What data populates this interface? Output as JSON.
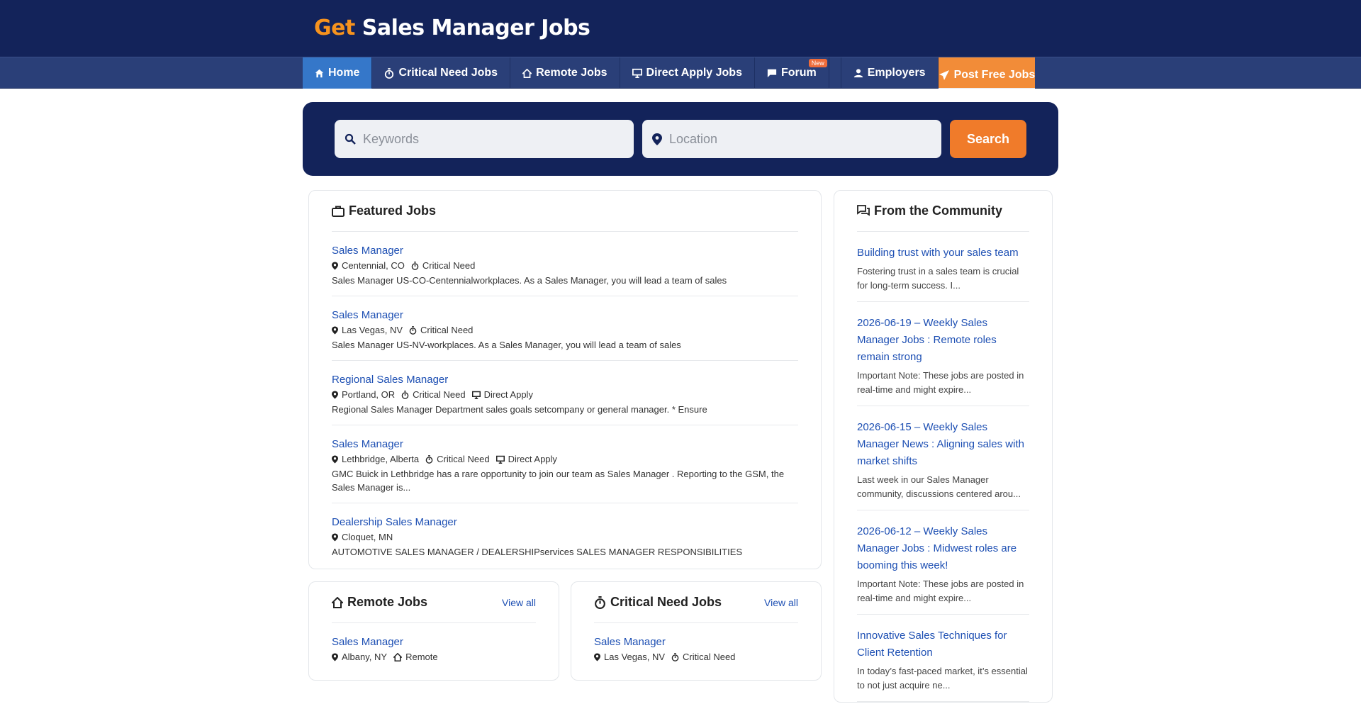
{
  "header": {
    "logo_highlight": "Get",
    "logo_rest": "Sales Manager Jobs"
  },
  "nav": {
    "home": "Home",
    "critical": "Critical Need Jobs",
    "remote": "Remote Jobs",
    "direct": "Direct Apply Jobs",
    "forum": "Forum",
    "forum_badge": "New",
    "employers": "Employers",
    "post": "Post Free Jobs"
  },
  "search": {
    "keywords_placeholder": "Keywords",
    "location_placeholder": "Location",
    "button": "Search"
  },
  "featured": {
    "title": "Featured Jobs",
    "jobs": [
      {
        "title": "Sales Manager",
        "location": "Centennial, CO",
        "tag1": "Critical Need",
        "desc": "Sales Manager US-CO-Centennialworkplaces. As a Sales Manager, you will lead a team of sales"
      },
      {
        "title": "Sales Manager",
        "location": "Las Vegas, NV",
        "tag1": "Critical Need",
        "desc": "Sales Manager US-NV-workplaces. As a Sales Manager, you will lead a team of sales"
      },
      {
        "title": "Regional Sales Manager",
        "location": "Portland, OR",
        "tag1": "Critical Need",
        "tag2": "Direct Apply",
        "desc": "Regional Sales Manager Department sales goals setcompany or general manager. * Ensure"
      },
      {
        "title": "Sales Manager",
        "location": "Lethbridge, Alberta",
        "tag1": "Critical Need",
        "tag2": "Direct Apply",
        "desc": "GMC Buick in Lethbridge has a rare opportunity to join our team as Sales Manager . Reporting to the GSM, the Sales Manager is..."
      },
      {
        "title": "Dealership Sales Manager",
        "location": "Cloquet, MN",
        "desc": "AUTOMOTIVE SALES MANAGER / DEALERSHIPservices SALES MANAGER RESPONSIBILITIES"
      }
    ]
  },
  "remote_card": {
    "title": "Remote Jobs",
    "view_all": "View all",
    "job": {
      "title": "Sales Manager",
      "location": "Albany, NY",
      "tag": "Remote"
    }
  },
  "critical_card": {
    "title": "Critical Need Jobs",
    "view_all": "View all",
    "job": {
      "title": "Sales Manager",
      "location": "Las Vegas, NV",
      "tag": "Critical Need"
    }
  },
  "community": {
    "title": "From the Community",
    "posts": [
      {
        "title": "Building trust with your sales team",
        "excerpt": "Fostering trust in a sales team is crucial for long-term success. I..."
      },
      {
        "title": "2026-06-19 – Weekly Sales Manager Jobs : Remote roles remain strong",
        "excerpt": "Important Note: These jobs are posted in real-time and might expire..."
      },
      {
        "title": "2026-06-15 – Weekly Sales Manager News : Aligning sales with market shifts",
        "excerpt": "Last week in our Sales Manager community, discussions centered arou..."
      },
      {
        "title": "2026-06-12 – Weekly Sales Manager Jobs : Midwest roles are booming this week!",
        "excerpt": "Important Note: These jobs are posted in real-time and might expire..."
      },
      {
        "title": "Innovative Sales Techniques for Client Retention",
        "excerpt": "In today’s fast-paced market, it’s essential to not just acquire ne..."
      }
    ]
  }
}
